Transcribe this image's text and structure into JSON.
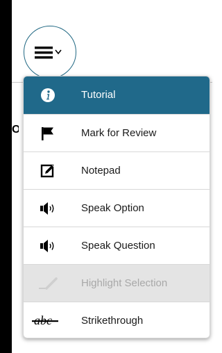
{
  "toolbar": {
    "edge_text": "O"
  },
  "menu": {
    "items": [
      {
        "label": "Tutorial",
        "icon": "info-icon",
        "state": "selected"
      },
      {
        "label": "Mark for Review",
        "icon": "flag-icon",
        "state": "normal"
      },
      {
        "label": "Notepad",
        "icon": "notepad-icon",
        "state": "normal"
      },
      {
        "label": "Speak Option",
        "icon": "speaker-icon",
        "state": "normal"
      },
      {
        "label": "Speak Question",
        "icon": "speaker-icon",
        "state": "normal"
      },
      {
        "label": "Highlight Selection",
        "icon": "highlighter-icon",
        "state": "disabled"
      },
      {
        "label": "Strikethrough",
        "icon": "strikethrough-icon",
        "state": "normal"
      }
    ]
  },
  "colors": {
    "accent": "#20698a",
    "button_border": "#1f6782",
    "disabled_bg": "#e4e4e4",
    "disabled_text": "#a8a8a8"
  }
}
